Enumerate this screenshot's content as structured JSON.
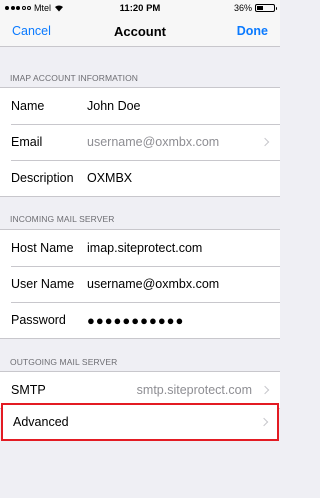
{
  "status_bar": {
    "carrier": "Mtel",
    "time": "11:20 PM",
    "battery": "36%",
    "battery_level": 0.36
  },
  "nav": {
    "cancel": "Cancel",
    "title": "Account",
    "done": "Done"
  },
  "sections": {
    "imap_header": "IMAP ACCOUNT INFORMATION",
    "incoming_header": "INCOMING MAIL SERVER",
    "outgoing_header": "OUTGOING MAIL SERVER"
  },
  "imap": {
    "name_label": "Name",
    "name_value": "John Doe",
    "email_label": "Email",
    "email_value": "username@oxmbx.com",
    "description_label": "Description",
    "description_value": "OXMBX"
  },
  "incoming": {
    "host_label": "Host Name",
    "host_value": "imap.siteprotect.com",
    "user_label": "User Name",
    "user_value": "username@oxmbx.com",
    "password_label": "Password",
    "password_value": "●●●●●●●●●●●"
  },
  "outgoing": {
    "smtp_label": "SMTP",
    "smtp_value": "smtp.siteprotect.com"
  },
  "advanced": {
    "label": "Advanced"
  }
}
